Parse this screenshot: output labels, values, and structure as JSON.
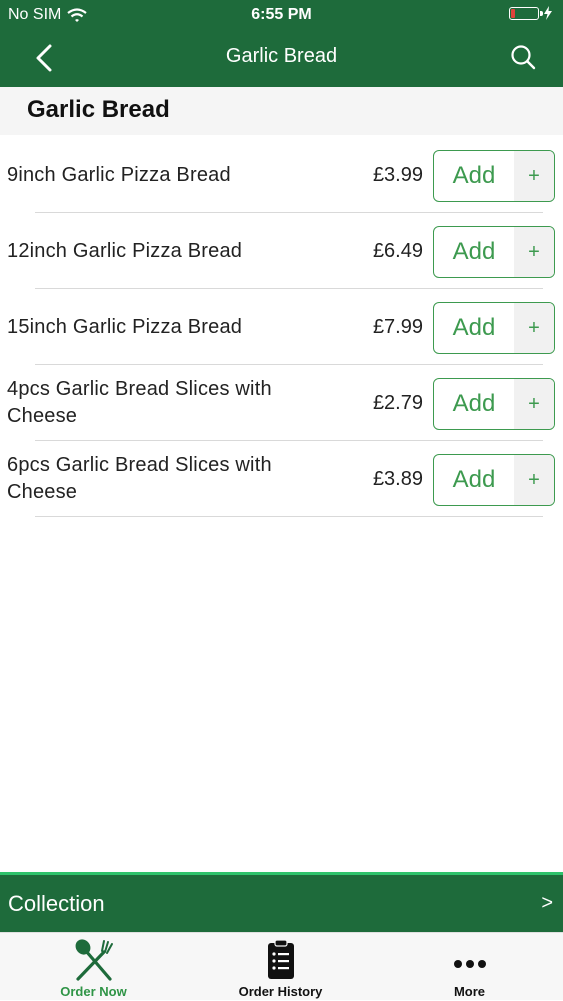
{
  "status_bar": {
    "carrier": "No SIM",
    "time": "6:55 PM",
    "battery_level": 0.15,
    "battery_color": "#e0433a"
  },
  "nav": {
    "title": "Garlic Bread",
    "back_icon": "chevron-left-icon",
    "search_icon": "search-icon"
  },
  "section": {
    "title": "Garlic Bread"
  },
  "menu_items": [
    {
      "name": "9inch Garlic Pizza Bread",
      "price": "£3.99",
      "add_label": "Add",
      "plus": "+"
    },
    {
      "name": "12inch Garlic Pizza Bread",
      "price": "£6.49",
      "add_label": "Add",
      "plus": "+"
    },
    {
      "name": "15inch Garlic Pizza Bread",
      "price": "£7.99",
      "add_label": "Add",
      "plus": "+"
    },
    {
      "name": "4pcs Garlic Bread Slices with Cheese",
      "price": "£2.79",
      "add_label": "Add",
      "plus": "+"
    },
    {
      "name": "6pcs Garlic Bread Slices with Cheese",
      "price": "£3.89",
      "add_label": "Add",
      "plus": "+"
    }
  ],
  "collection_bar": {
    "label": "Collection",
    "arrow": ">"
  },
  "tabs": [
    {
      "label": "Order Now",
      "icon": "fork-spoon-icon",
      "active": true
    },
    {
      "label": "Order History",
      "icon": "clipboard-list-icon",
      "active": false
    },
    {
      "label": "More",
      "icon": "more-dots-icon",
      "active": false
    }
  ],
  "colors": {
    "brand_green": "#1e6b3b",
    "accent_green": "#3d9a4f",
    "collection_border": "#2ec26b",
    "active_tab": "#2f9446"
  }
}
